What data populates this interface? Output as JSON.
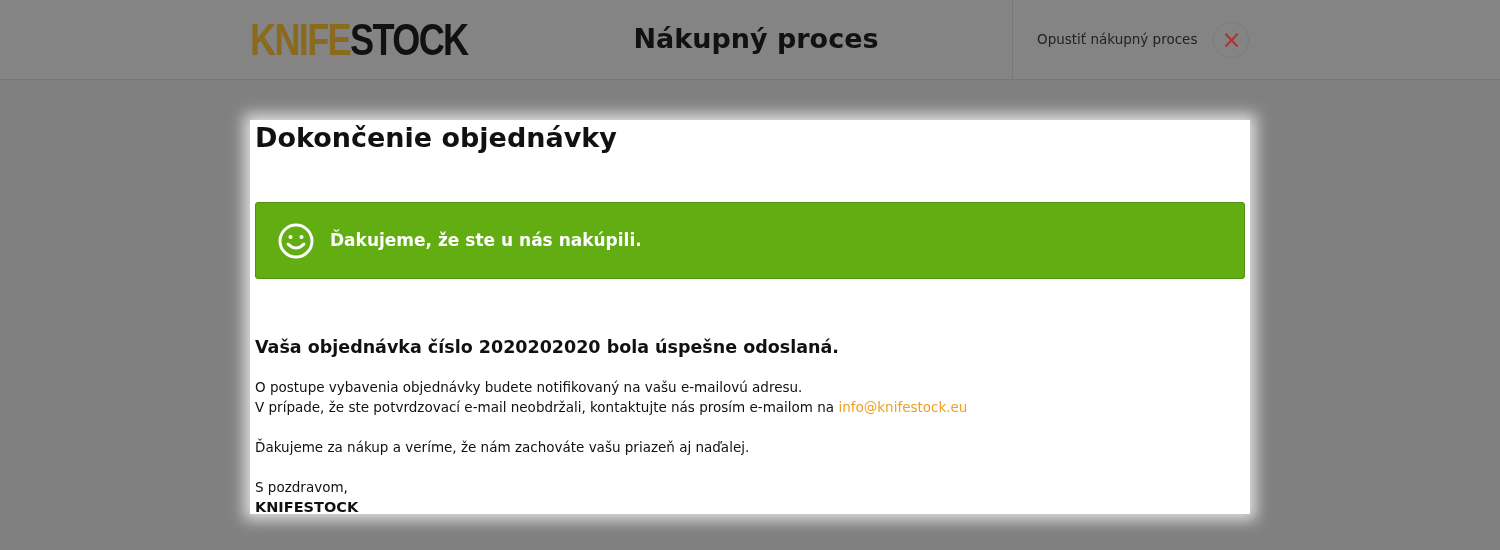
{
  "header": {
    "logo": {
      "accent": "KNIFE",
      "rest": "STOCK"
    },
    "title": "Nákupný proces",
    "exit_label": "Opustiť nákupný proces",
    "close_symbol": "×"
  },
  "dialog": {
    "title": "Dokončenie objednávky",
    "alert": {
      "text": "Ďakujeme, že ste u nás nakúpili."
    },
    "heading": "Vaša objednávka číslo 2020202020 bola úspešne odoslaná.",
    "lines": [
      {
        "text": "O postupe vybavenia objednávky budete notifikovaný na vašu e-mailovú adresu."
      },
      {
        "text": "V prípade, že ste potvrdzovací e-mail neobdržali, kontaktujte nás prosím e-mailom na",
        "link": "info@knifestock.eu"
      }
    ],
    "thanks": "Ďakujeme za nákup a veríme, že nám zachováte vašu priazeň aj naďalej.",
    "greeting": "S pozdravom,",
    "signature": "KNIFESTOCK"
  }
}
